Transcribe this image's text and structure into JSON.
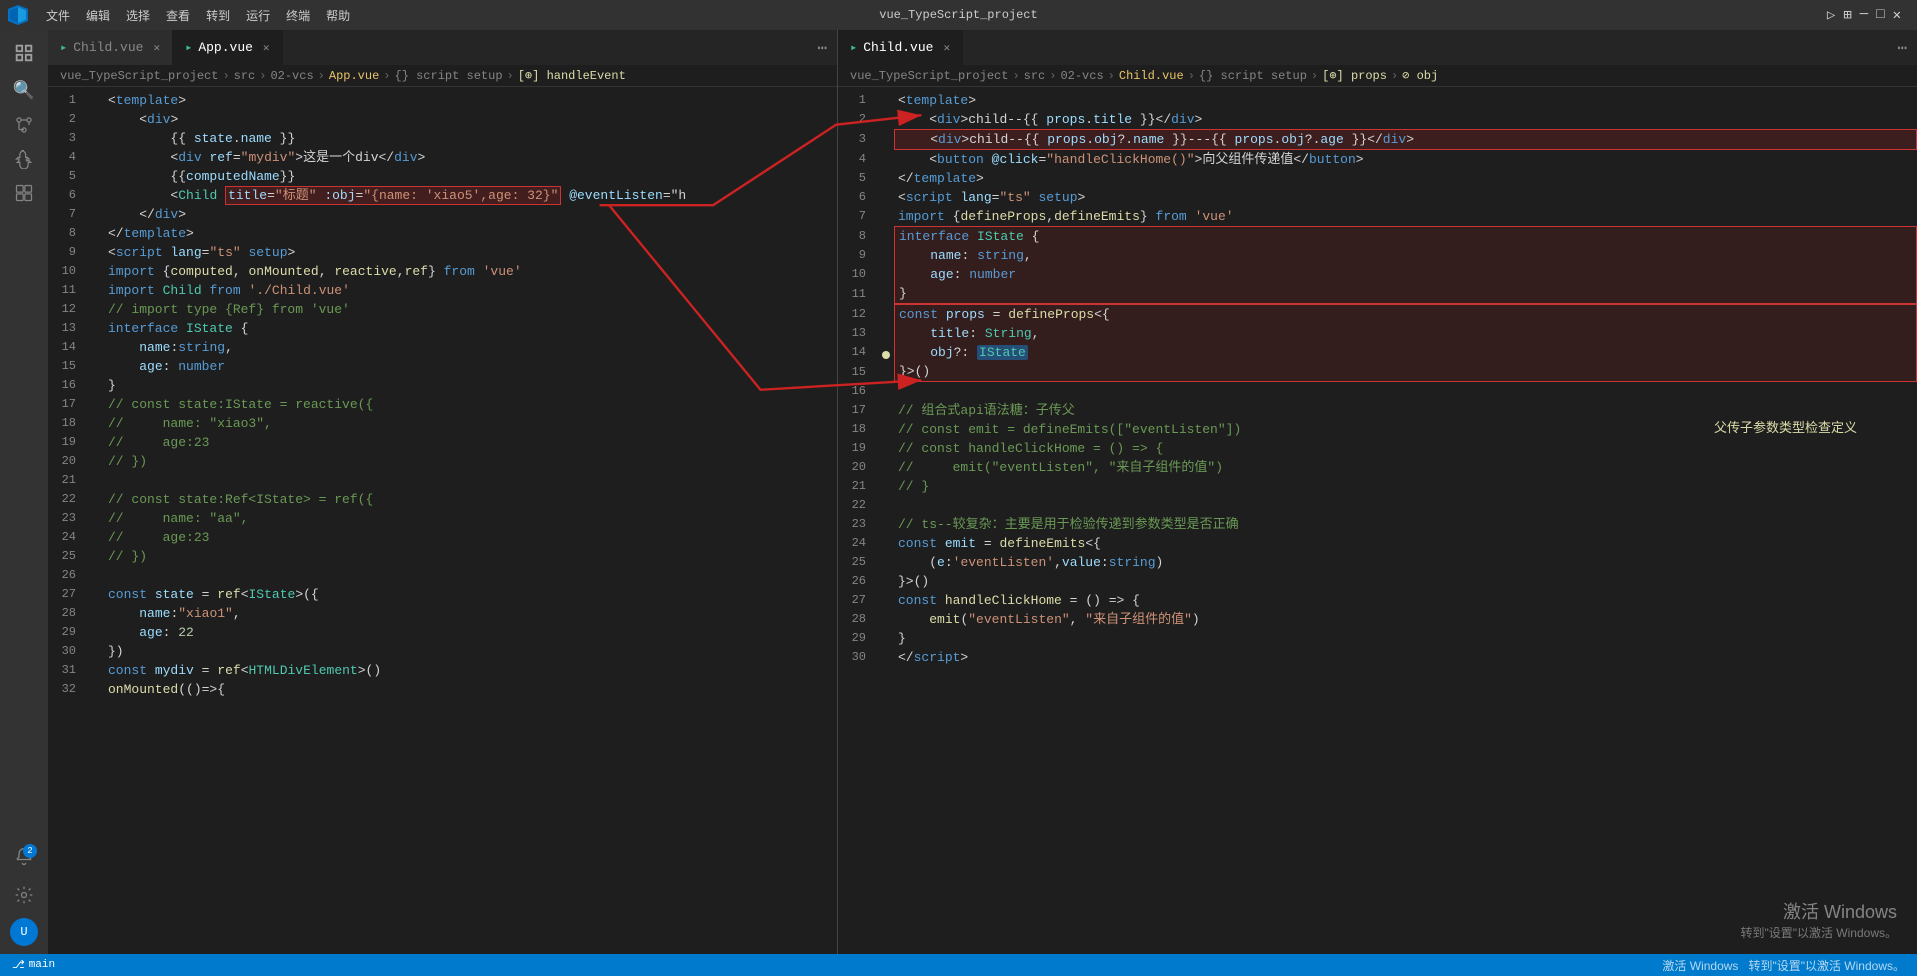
{
  "app": {
    "title": "VS Code - Vue TypeScript Project"
  },
  "toolbar": {
    "menus": [
      "文件",
      "编辑",
      "选择",
      "查看",
      "转到",
      "运行",
      "终端",
      "帮助"
    ]
  },
  "left_editor": {
    "tabs": [
      {
        "label": "Child.vue",
        "active": false,
        "color": "#42b883"
      },
      {
        "label": "App.vue",
        "active": true,
        "color": "#42b883"
      }
    ],
    "breadcrumb": "vue_TypeScript_project > src > 02-vcs > App.vue > {} script setup > [⊕] handleEvent",
    "filename": "App.vue"
  },
  "right_editor": {
    "tabs": [
      {
        "label": "Child.vue",
        "active": true,
        "color": "#42b883"
      }
    ],
    "breadcrumb": "vue_TypeScript_project > src > 02-vcs > Child.vue > {} script setup > [⊕] props > ⊘ obj",
    "filename": "Child.vue"
  },
  "annotation": {
    "label": "父传子参数类型检查定义"
  },
  "windows_activate": {
    "line1": "激活 Windows",
    "line2": "转到\"设置\"以激活 Windows。"
  }
}
